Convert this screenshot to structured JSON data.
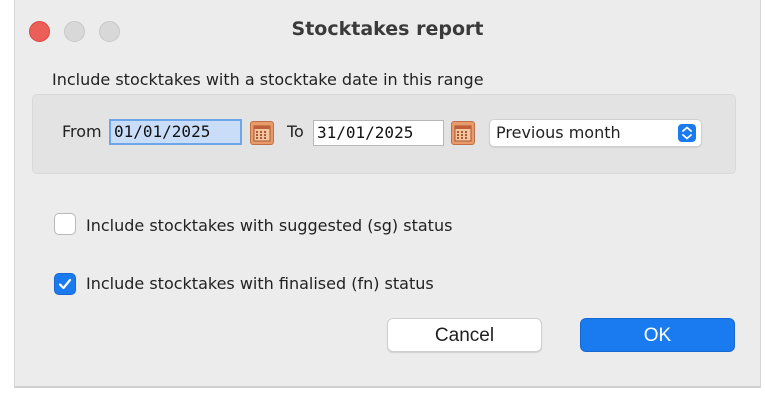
{
  "window": {
    "title": "Stocktakes report"
  },
  "date_range": {
    "group_label": "Include stocktakes with a stocktake date in this range",
    "from_label": "From",
    "from_value": "01/01/2025",
    "to_label": "To",
    "to_value": "31/01/2025",
    "preset_selected": "Previous month"
  },
  "options": {
    "suggested": {
      "label": "Include stocktakes with suggested (sg) status",
      "checked": false
    },
    "finalised": {
      "label": "Include stocktakes with finalised (fn) status",
      "checked": true
    }
  },
  "buttons": {
    "cancel_label": "Cancel",
    "ok_label": "OK"
  },
  "colors": {
    "accent": "#1a7bf0",
    "close_button": "#ec5f59",
    "calendar_button": "#e89a6a",
    "focus_fill": "#c9ddf8"
  },
  "icons": {
    "calendar": "calendar-icon",
    "select_arrows": "chevron-up-down-icon",
    "checkmark": "checkmark-icon"
  }
}
